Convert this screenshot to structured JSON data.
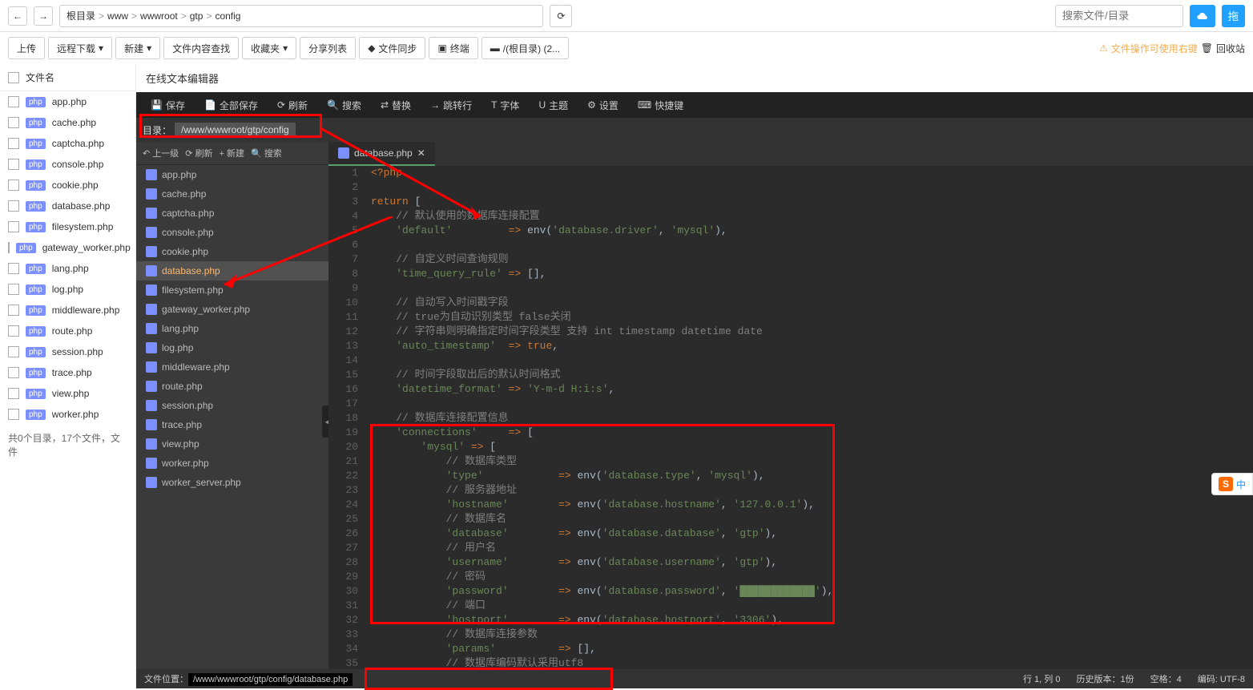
{
  "breadcrumb": [
    "根目录",
    "www",
    "wwwroot",
    "gtp",
    "config"
  ],
  "search_placeholder": "搜索文件/目录",
  "drag_btn": "拖",
  "toolbar": {
    "upload": "上传",
    "remote_dl": "远程下载",
    "new": "新建",
    "content_search": "文件内容查找",
    "favorites": "收藏夹",
    "share_list": "分享列表",
    "file_sync": "文件同步",
    "terminal": "终端",
    "root_dir": "/(根目录) (2...",
    "warn": "文件操作可使用右键",
    "trash": "回收站"
  },
  "list_header": "文件名",
  "left_files": [
    "app.php",
    "cache.php",
    "captcha.php",
    "console.php",
    "cookie.php",
    "database.php",
    "filesystem.php",
    "gateway_worker.php",
    "lang.php",
    "log.php",
    "middleware.php",
    "route.php",
    "session.php",
    "trace.php",
    "view.php",
    "worker.php"
  ],
  "list_footer": "共0个目录，17个文件，文件",
  "editor_title": "在线文本编辑器",
  "editor_toolbar": [
    "保存",
    "全部保存",
    "刷新",
    "搜索",
    "替换",
    "跳转行",
    "字体",
    "主题",
    "设置",
    "快捷键"
  ],
  "editor_toolbar_icons": [
    "save-icon",
    "save-all-icon",
    "refresh-icon",
    "search-icon",
    "replace-icon",
    "goto-icon",
    "font-icon",
    "theme-icon",
    "settings-icon",
    "keyboard-icon"
  ],
  "path_label": "目录：",
  "path_value": "/www/wwwroot/gtp/config",
  "tree_toolbar": {
    "up": "上一级",
    "refresh": "刷新",
    "new": "新建",
    "search": "搜索"
  },
  "tree_files": [
    "app.php",
    "cache.php",
    "captcha.php",
    "console.php",
    "cookie.php",
    "database.php",
    "filesystem.php",
    "gateway_worker.php",
    "lang.php",
    "log.php",
    "middleware.php",
    "route.php",
    "session.php",
    "trace.php",
    "view.php",
    "worker.php",
    "worker_server.php"
  ],
  "tree_active": "database.php",
  "tab_name": "database.php",
  "code": {
    "lines": [
      {
        "n": 1,
        "html": "<span class='s-key'>&lt;?php</span>"
      },
      {
        "n": 2,
        "html": ""
      },
      {
        "n": 3,
        "html": "<span class='s-key'>return</span> ["
      },
      {
        "n": 4,
        "html": "    <span class='s-com'>// 默认使用的数据库连接配置</span>"
      },
      {
        "n": 5,
        "html": "    <span class='s-str'>'default'</span>         <span class='s-arr'>=&gt;</span> env(<span class='s-str'>'database.driver'</span>, <span class='s-str'>'mysql'</span>),"
      },
      {
        "n": 6,
        "html": ""
      },
      {
        "n": 7,
        "html": "    <span class='s-com'>// 自定义时间查询规则</span>"
      },
      {
        "n": 8,
        "html": "    <span class='s-str'>'time_query_rule'</span> <span class='s-arr'>=&gt;</span> [],"
      },
      {
        "n": 9,
        "html": ""
      },
      {
        "n": 10,
        "html": "    <span class='s-com'>// 自动写入时间戳字段</span>"
      },
      {
        "n": 11,
        "html": "    <span class='s-com'>// true为自动识别类型 false关闭</span>"
      },
      {
        "n": 12,
        "html": "    <span class='s-com'>// 字符串则明确指定时间字段类型 支持 int timestamp datetime date</span>"
      },
      {
        "n": 13,
        "html": "    <span class='s-str'>'auto_timestamp'</span>  <span class='s-arr'>=&gt;</span> <span class='s-lit'>true</span>,"
      },
      {
        "n": 14,
        "html": ""
      },
      {
        "n": 15,
        "html": "    <span class='s-com'>// 时间字段取出后的默认时间格式</span>"
      },
      {
        "n": 16,
        "html": "    <span class='s-str'>'datetime_format'</span> <span class='s-arr'>=&gt;</span> <span class='s-str'>'Y-m-d H:i:s'</span>,"
      },
      {
        "n": 17,
        "html": ""
      },
      {
        "n": 18,
        "html": "    <span class='s-com'>// 数据库连接配置信息</span>"
      },
      {
        "n": 19,
        "html": "    <span class='s-str'>'connections'</span>     <span class='s-arr'>=&gt;</span> ["
      },
      {
        "n": 20,
        "html": "        <span class='s-str'>'mysql'</span> <span class='s-arr'>=&gt;</span> ["
      },
      {
        "n": 21,
        "html": "            <span class='s-com'>// 数据库类型</span>"
      },
      {
        "n": 22,
        "html": "            <span class='s-str'>'type'</span>            <span class='s-arr'>=&gt;</span> env(<span class='s-str'>'database.type'</span>, <span class='s-str'>'mysql'</span>),"
      },
      {
        "n": 23,
        "html": "            <span class='s-com'>// 服务器地址</span>"
      },
      {
        "n": 24,
        "html": "            <span class='s-str'>'hostname'</span>        <span class='s-arr'>=&gt;</span> env(<span class='s-str'>'database.hostname'</span>, <span class='s-str'>'127.0.0.1'</span>),"
      },
      {
        "n": 25,
        "html": "            <span class='s-com'>// 数据库名</span>"
      },
      {
        "n": 26,
        "html": "            <span class='s-str'>'database'</span>        <span class='s-arr'>=&gt;</span> env(<span class='s-str'>'database.database'</span>, <span class='s-str'>'gtp'</span>),"
      },
      {
        "n": 27,
        "html": "            <span class='s-com'>// 用户名</span>"
      },
      {
        "n": 28,
        "html": "            <span class='s-str'>'username'</span>        <span class='s-arr'>=&gt;</span> env(<span class='s-str'>'database.username'</span>, <span class='s-str'>'gtp'</span>),"
      },
      {
        "n": 29,
        "html": "            <span class='s-com'>// 密码</span>"
      },
      {
        "n": 30,
        "html": "            <span class='s-str'>'password'</span>        <span class='s-arr'>=&gt;</span> env(<span class='s-str'>'database.password'</span>, <span class='s-str'>'████████████'</span>),"
      },
      {
        "n": 31,
        "html": "            <span class='s-com'>// 端口</span>"
      },
      {
        "n": 32,
        "html": "            <span class='s-str'>'hostport'</span>        <span class='s-arr'>=&gt;</span> env(<span class='s-str'>'database.hostport'</span>, <span class='s-str'>'3306'</span>),"
      },
      {
        "n": 33,
        "html": "            <span class='s-com'>// 数据库连接参数</span>"
      },
      {
        "n": 34,
        "html": "            <span class='s-str'>'params'</span>          <span class='s-arr'>=&gt;</span> [],"
      },
      {
        "n": 35,
        "html": "            <span class='s-com'>// 数据库编码默认采用utf8</span>"
      }
    ]
  },
  "status": {
    "file_pos_label": "文件位置：",
    "file_pos_value": "/www/wwwroot/gtp/config/database.php",
    "line_col": "行 1, 列 0",
    "history": "历史版本：1份",
    "spaces": "空格：4",
    "encoding": "编码: UTF-8"
  },
  "ime_badge": "中"
}
